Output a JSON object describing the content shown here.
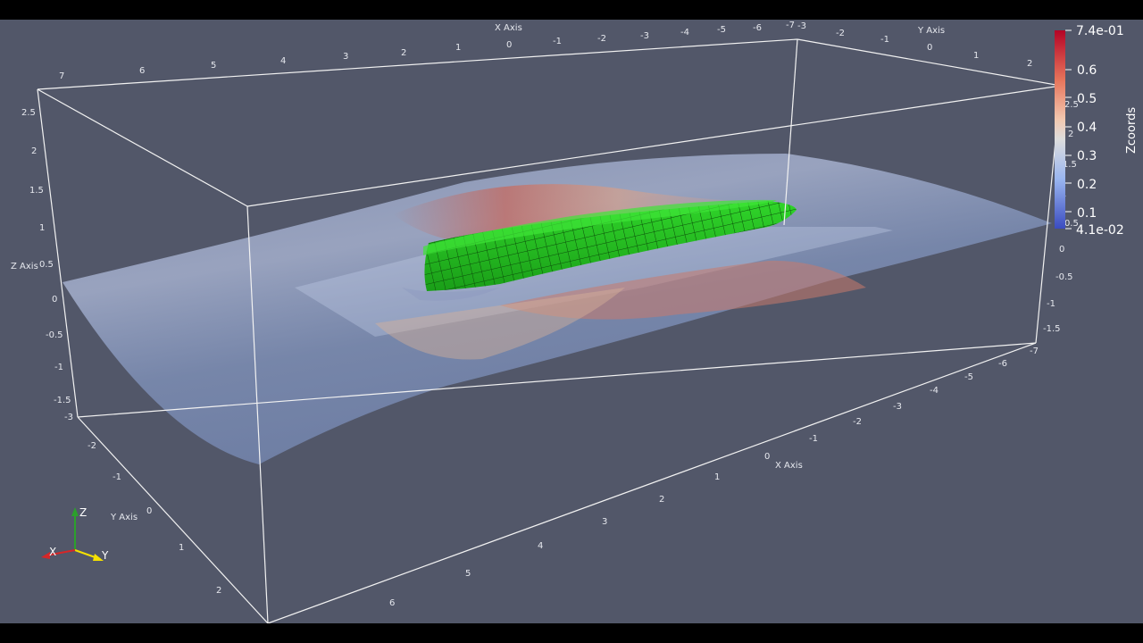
{
  "axes": {
    "x_axis_label": "X Axis",
    "y_axis_label": "Y Axis",
    "z_axis_label": "Z Axis",
    "x_ticks_top": [
      "7",
      "6",
      "5",
      "4",
      "3",
      "2",
      "1",
      "0",
      "-1",
      "-2",
      "-3",
      "-4",
      "-5",
      "-6",
      "-7"
    ],
    "y_ticks_top": [
      "-3",
      "-2",
      "-1",
      "0",
      "1",
      "2"
    ],
    "z_ticks_left": [
      "2.5",
      "2",
      "1.5",
      "1",
      "0.5",
      "0",
      "-0.5",
      "-1",
      "-1.5"
    ],
    "z_ticks_right": [
      "2.5",
      "2",
      "1.5",
      "1",
      "0.5",
      "0",
      "-0.5",
      "-1",
      "-1.5"
    ],
    "x_ticks_bottom": [
      "6",
      "5",
      "4",
      "3",
      "2",
      "1",
      "0",
      "-1",
      "-2",
      "-3",
      "-4",
      "-5",
      "-6",
      "-7"
    ],
    "y_ticks_bottom": [
      "-3",
      "-2",
      "-1",
      "0",
      "1",
      "2"
    ]
  },
  "colorbar": {
    "title": "Zcoords",
    "max_label": "7.4e-01",
    "min_label": "4.1e-02",
    "tick_labels": [
      "0.6",
      "0.5",
      "0.4",
      "0.3",
      "0.2",
      "0.1"
    ],
    "color_high": "#b40426",
    "color_mid": "#dddddd",
    "color_low": "#3b4cc0"
  },
  "orientation_triad": {
    "x_label": "X",
    "y_label": "Y",
    "z_label": "Z",
    "x_color": "#d62728",
    "y_color": "#f5e000",
    "z_color": "#2ca02c"
  },
  "scene": {
    "background_color": "#525769",
    "hull_color": "#22c21e",
    "grid_color": "#f2f2f2"
  }
}
